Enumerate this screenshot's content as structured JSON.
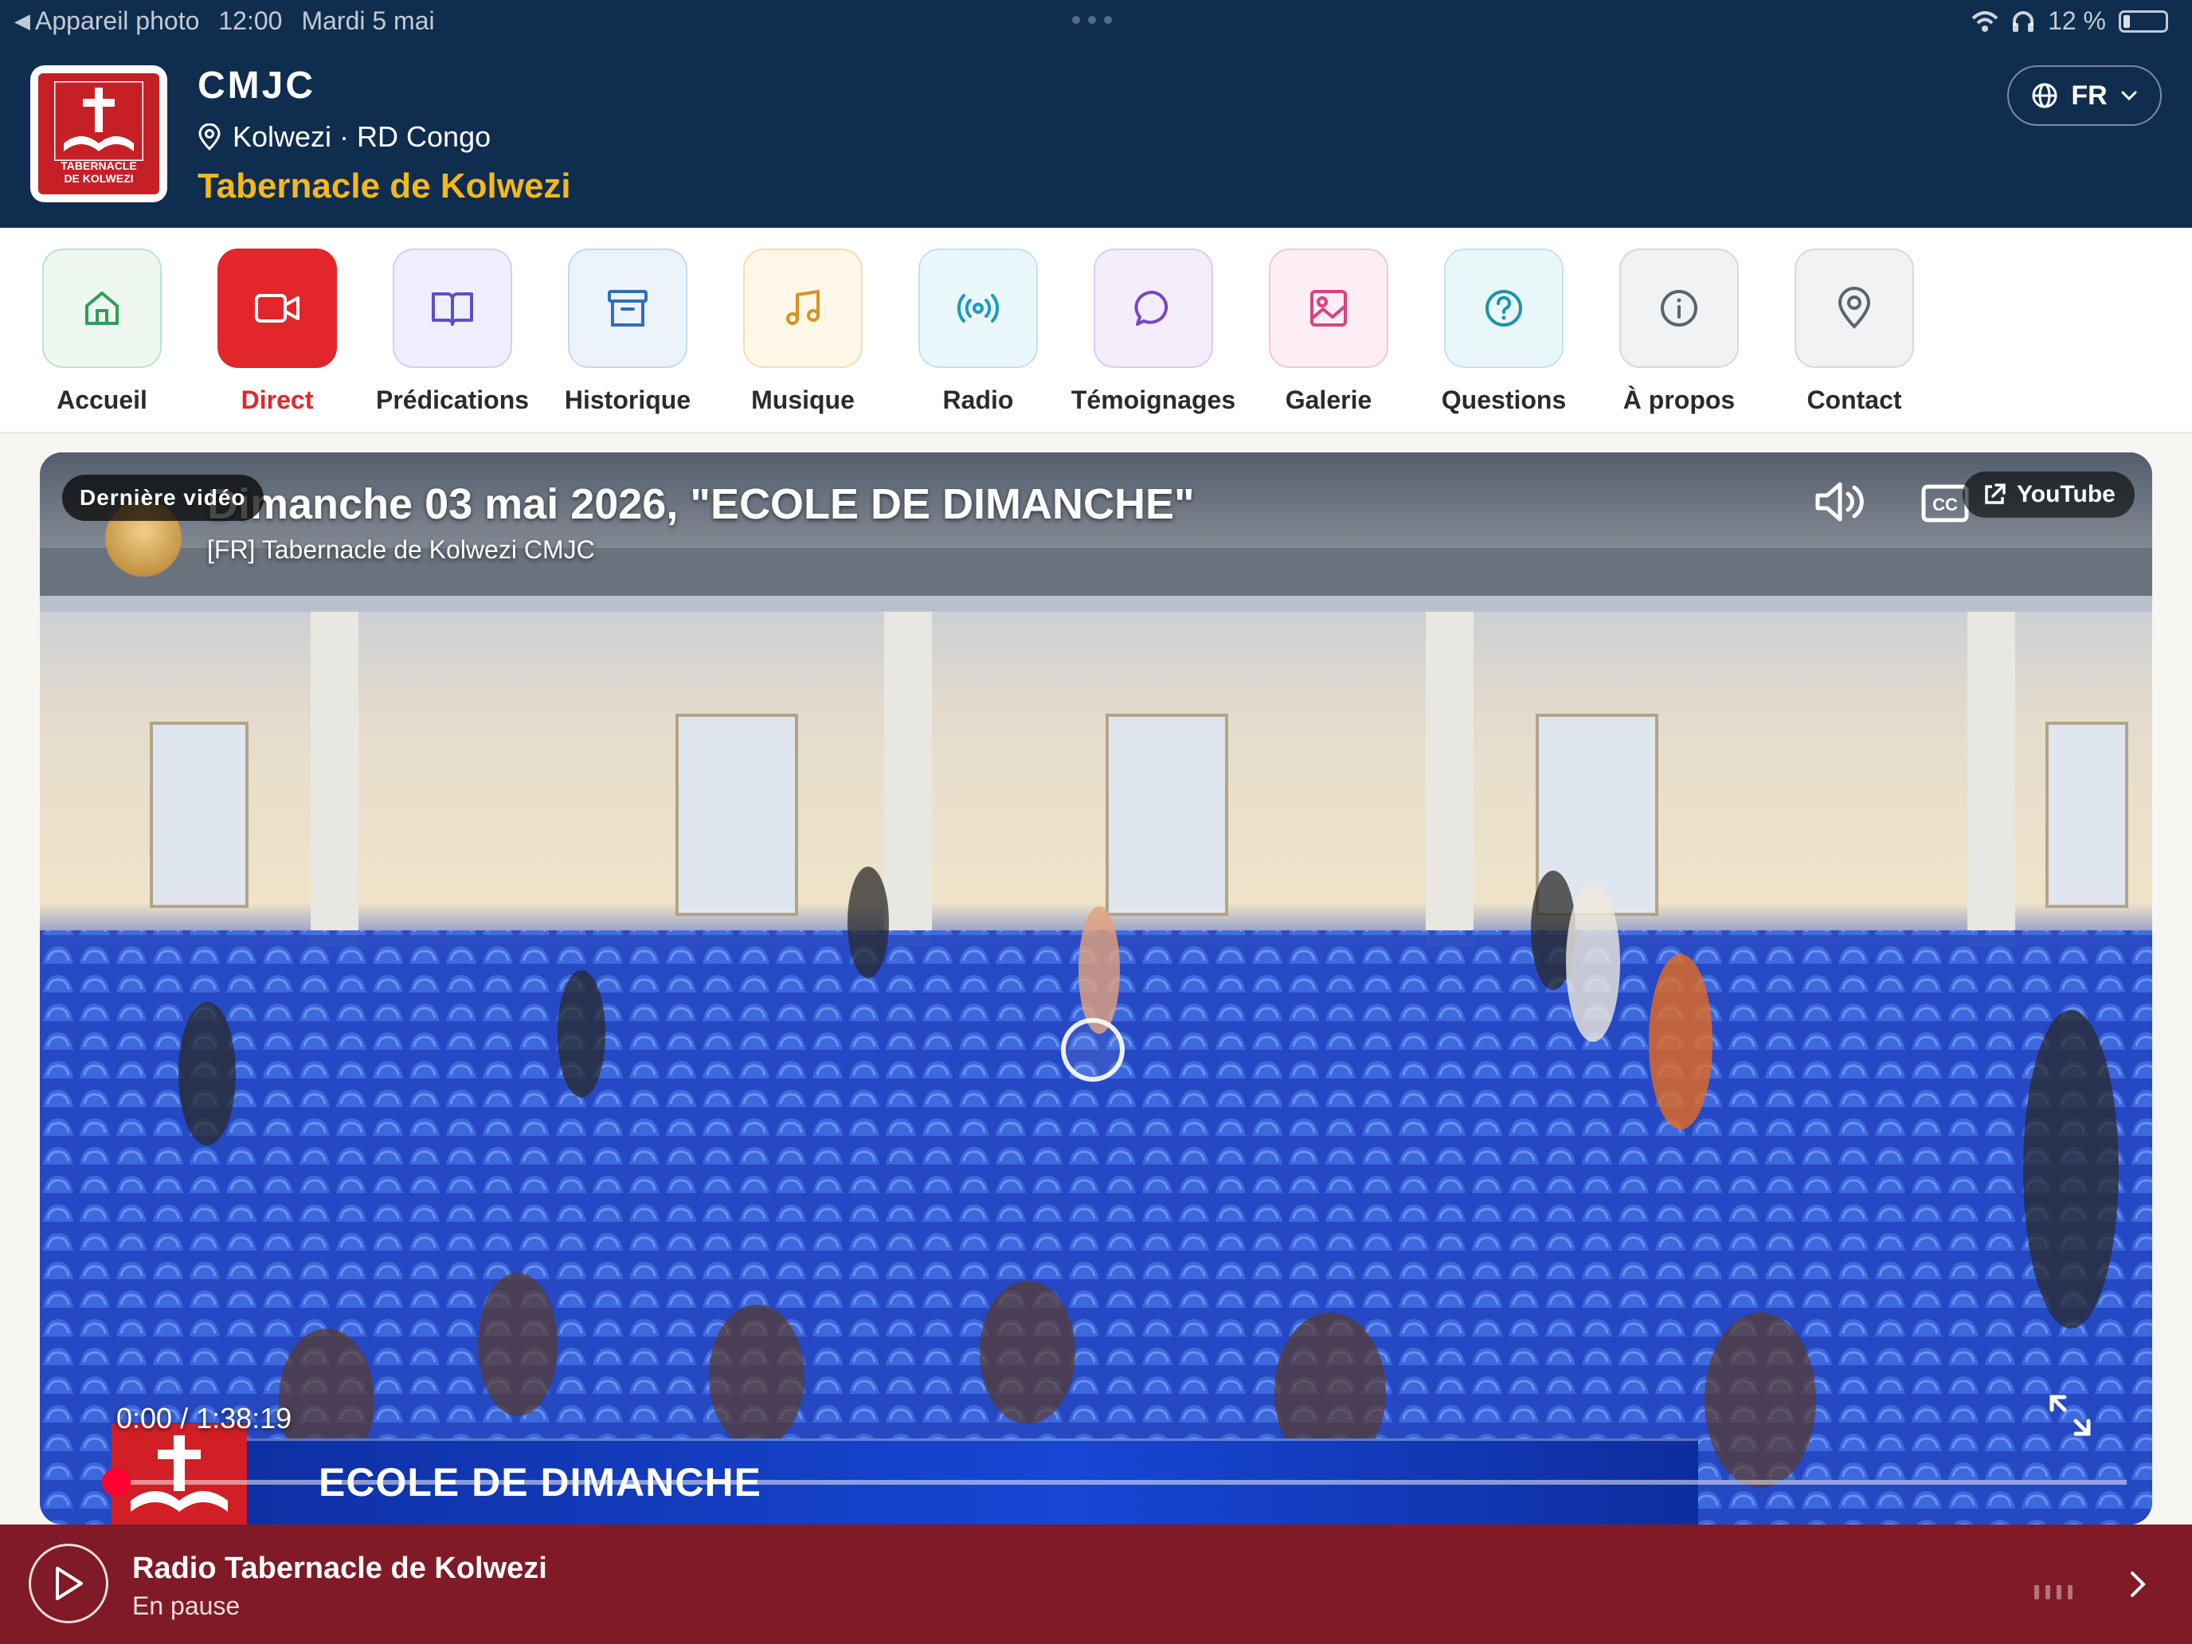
{
  "status_bar": {
    "back_app": "Appareil photo",
    "time": "12:00",
    "date": "Mardi 5 mai",
    "battery": "12 %"
  },
  "header": {
    "logo_text_line1": "TABERNACLE",
    "logo_text_line2": "DE KOLWEZI",
    "brand_name": "CMJC",
    "location": "Kolwezi · RD Congo",
    "subtitle": "Tabernacle de Kolwezi",
    "language": "FR"
  },
  "nav": {
    "items": [
      {
        "label": "Accueil",
        "icon": "home-icon",
        "active": false
      },
      {
        "label": "Direct",
        "icon": "video-camera-icon",
        "active": true
      },
      {
        "label": "Prédications",
        "icon": "book-icon",
        "active": false
      },
      {
        "label": "Historique",
        "icon": "archive-icon",
        "active": false
      },
      {
        "label": "Musique",
        "icon": "music-icon",
        "active": false
      },
      {
        "label": "Radio",
        "icon": "radio-icon",
        "active": false
      },
      {
        "label": "Témoignages",
        "icon": "chat-icon",
        "active": false
      },
      {
        "label": "Galerie",
        "icon": "image-icon",
        "active": false
      },
      {
        "label": "Questions",
        "icon": "question-icon",
        "active": false
      },
      {
        "label": "À propos",
        "icon": "info-icon",
        "active": false
      },
      {
        "label": "Contact",
        "icon": "map-pin-icon",
        "active": false
      }
    ]
  },
  "video": {
    "badge": "Dernière vidéo",
    "title": "Dimanche 03 mai 2026, \"ECOLE DE DIMANCHE\"",
    "channel": "[FR] Tabernacle de Kolwezi CMJC",
    "youtube_label": "YouTube",
    "time": "0:00 / 1:38:19",
    "lower_third": "ECOLE DE DIMANCHE",
    "progress": 0
  },
  "player": {
    "title": "Radio Tabernacle de Kolwezi",
    "status": "En pause"
  },
  "colors": {
    "header_bg": "#0f2d4f",
    "accent_gold": "#f5b81b",
    "active_red": "#e3262b",
    "player_bg": "#7f1a26"
  }
}
